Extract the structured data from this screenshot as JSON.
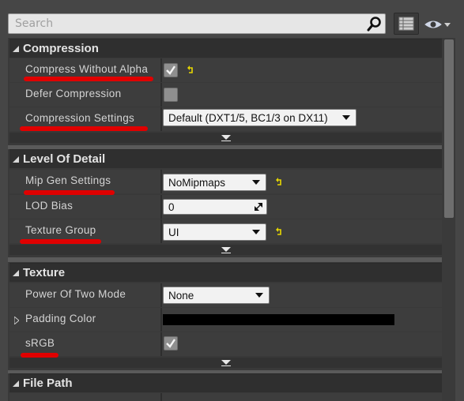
{
  "search": {
    "placeholder": "Search"
  },
  "icons": {
    "search": "magnifier-icon",
    "view_options": "list-icon",
    "visibility": "eye-icon"
  },
  "categories": {
    "compression": {
      "title": "Compression",
      "rows": {
        "compress_without_alpha": {
          "label": "Compress Without Alpha",
          "checked": true
        },
        "defer_compression": {
          "label": "Defer Compression",
          "checked": false
        },
        "compression_settings": {
          "label": "Compression Settings",
          "value": "Default (DXT1/5, BC1/3 on DX11)"
        }
      }
    },
    "level_of_detail": {
      "title": "Level Of Detail",
      "rows": {
        "mip_gen_settings": {
          "label": "Mip Gen Settings",
          "value": "NoMipmaps"
        },
        "lod_bias": {
          "label": "LOD Bias",
          "value": "0"
        },
        "texture_group": {
          "label": "Texture Group",
          "value": "UI"
        }
      }
    },
    "texture": {
      "title": "Texture",
      "rows": {
        "power_of_two_mode": {
          "label": "Power Of Two Mode",
          "value": "None"
        },
        "padding_color": {
          "label": "Padding Color",
          "color": "#000000"
        },
        "srgb": {
          "label": "sRGB",
          "checked": true
        }
      }
    },
    "file_path": {
      "title": "File Path"
    }
  },
  "colors": {
    "annotation_underline": "#e00000",
    "reset_arrow": "#e8d800"
  }
}
